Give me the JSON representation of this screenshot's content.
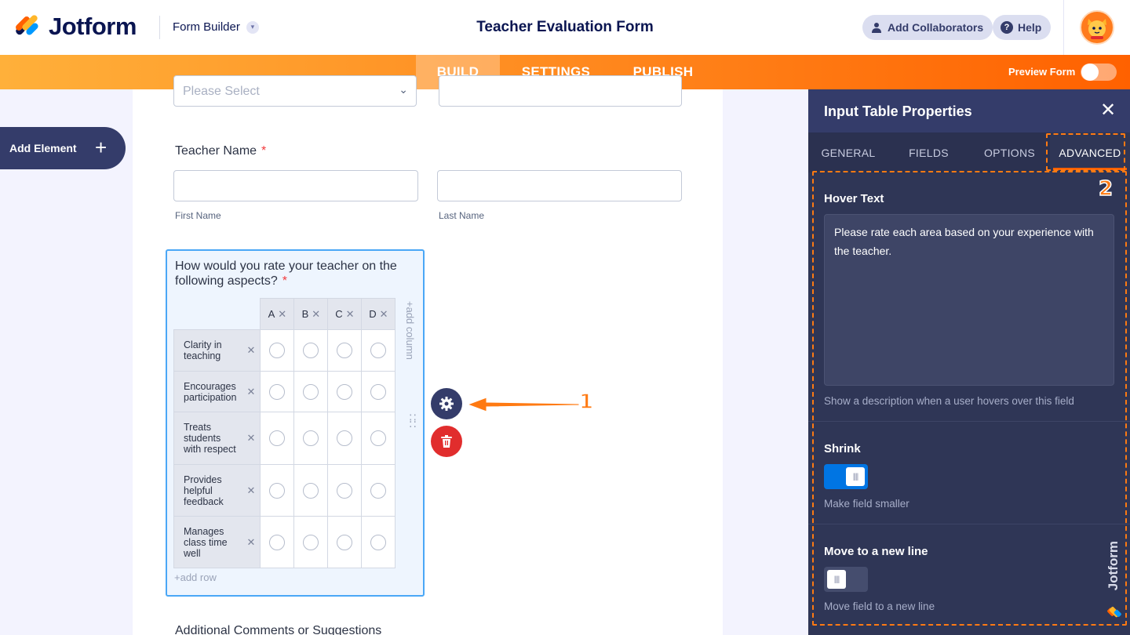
{
  "header": {
    "brand": "Jotform",
    "builder_label": "Form Builder",
    "form_title": "Teacher Evaluation Form",
    "add_collaborators": "Add Collaborators",
    "help": "Help"
  },
  "nav": {
    "tabs": [
      "BUILD",
      "SETTINGS",
      "PUBLISH"
    ],
    "active_tab": "BUILD",
    "preview_label": "Preview Form",
    "preview_on": false
  },
  "left": {
    "add_element": "Add Element"
  },
  "form": {
    "select_placeholder": "Please Select",
    "teacher_name_label": "Teacher Name",
    "required_mark": "*",
    "first_name": "First Name",
    "last_name": "Last Name",
    "question": "How would you rate your teacher on the following aspects?",
    "columns": [
      "A",
      "B",
      "C",
      "D"
    ],
    "rows": [
      "Clarity in teaching",
      "Encourages participation",
      "Treats students with respect",
      "Provides helpful feedback",
      "Manages class time well"
    ],
    "add_column": "+add column",
    "add_row": "+add row",
    "next_field_label": "Additional Comments or Suggestions"
  },
  "annotations": {
    "one": "1",
    "two": "2"
  },
  "panel": {
    "title": "Input Table Properties",
    "tabs": [
      "GENERAL",
      "FIELDS",
      "OPTIONS",
      "ADVANCED"
    ],
    "active_tab": "ADVANCED",
    "hover_text_label": "Hover Text",
    "hover_text_value": "Please rate each area based on your experience with the teacher.",
    "hover_text_desc": "Show a description when a user hovers over this field",
    "shrink_label": "Shrink",
    "shrink_on": true,
    "shrink_desc": "Make field smaller",
    "newline_label": "Move to a new line",
    "newline_on": false,
    "newline_desc": "Move field to a new line",
    "watermark": "Jotform"
  },
  "colors": {
    "orange": "#ff6100",
    "navy": "#0a1551",
    "panel_bg": "#2f3656",
    "toggle_on": "#0075e3",
    "select_border": "#4aa7f6",
    "delete_red": "#e12d2d"
  }
}
